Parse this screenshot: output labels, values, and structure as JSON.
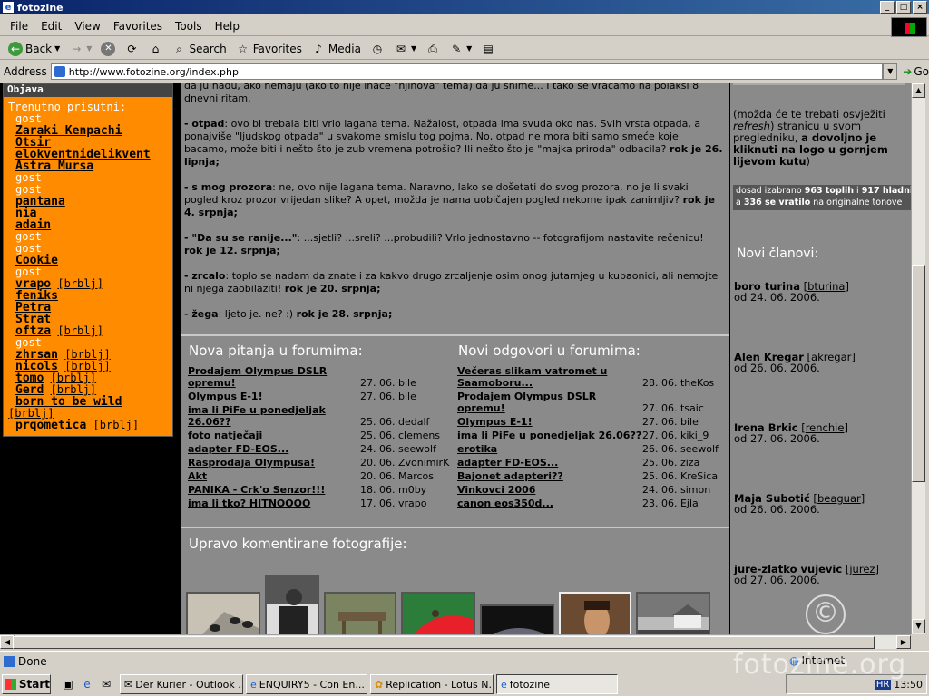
{
  "window": {
    "title": "fotozine"
  },
  "menu": [
    "File",
    "Edit",
    "View",
    "Favorites",
    "Tools",
    "Help"
  ],
  "toolbar": {
    "back": "Back",
    "search": "Search",
    "favorites": "Favorites",
    "media": "Media"
  },
  "address": {
    "label": "Address",
    "url": "http://www.fotozine.org/index.php",
    "go": "Go"
  },
  "left": {
    "header": "Objava",
    "present_label": "Trenutno prisutni:",
    "users": [
      {
        "name": "gost",
        "type": "guest"
      },
      {
        "name": "Zaraki Kenpachi",
        "type": "user"
      },
      {
        "name": "Otsir",
        "type": "user"
      },
      {
        "name": "elokventnidelikvent",
        "type": "user"
      },
      {
        "name": "Astra Mursa",
        "type": "user"
      },
      {
        "name": "gost",
        "type": "guest"
      },
      {
        "name": "gost",
        "type": "guest"
      },
      {
        "name": "pantana",
        "type": "user"
      },
      {
        "name": "nia",
        "type": "user"
      },
      {
        "name": "adain",
        "type": "user"
      },
      {
        "name": "gost",
        "type": "guest"
      },
      {
        "name": "gost",
        "type": "guest"
      },
      {
        "name": "Cookie",
        "type": "user"
      },
      {
        "name": "gost",
        "type": "guest"
      },
      {
        "name": "vrapo",
        "type": "user",
        "extra": "[brblj]"
      },
      {
        "name": "feniks",
        "type": "user"
      },
      {
        "name": "Petra",
        "type": "user"
      },
      {
        "name": "Strat",
        "type": "user"
      },
      {
        "name": "oftza",
        "type": "user",
        "extra": "[brblj]"
      },
      {
        "name": "gost",
        "type": "guest"
      },
      {
        "name": "zhrsan",
        "type": "user",
        "extra": "[brblj]"
      },
      {
        "name": "nicols",
        "type": "user",
        "extra": "[brblj]"
      },
      {
        "name": "tomo",
        "type": "user",
        "extra": "[brblj]"
      },
      {
        "name": "Gerd",
        "type": "user",
        "extra": "[brblj]"
      },
      {
        "name": "born to be wild",
        "type": "user",
        "extra": "[brblj]",
        "wrap": true
      },
      {
        "name": "prqometica",
        "type": "user",
        "extra": "[brblj]"
      }
    ]
  },
  "topics": [
    {
      "lead": "",
      "text": "da ju nađu, ako nemaju (ako to nije inače \"njihova\" tema) da ju snime... I tako se vraćamo na polaksi 8 dnevni ritam.",
      "deadline": ""
    },
    {
      "lead": "- otpad",
      "text": ": ovo bi trebala biti vrlo lagana tema. Nažalost, otpada ima svuda oko nas. Svih vrsta otpada, a ponajviše \"ljudskog otpada\" u svakome smislu tog pojma. No, otpad ne mora biti samo smeće koje bacamo, može biti i nešto što je zub vremena potrošio? Ili nešto što je \"majka priroda\" odbacila?",
      "deadline": "rok je 26. lipnja;"
    },
    {
      "lead": "- s mog prozora",
      "text": ": ne, ovo nije lagana tema. Naravno, lako se došetati do svog prozora, no je li svaki pogled kroz prozor vrijedan slike? A opet, možda je nama uobičajen pogled nekome ipak zanimljiv?",
      "deadline": "rok je 4. srpnja;"
    },
    {
      "lead": "- \"Da su se ranije...\"",
      "text": ": ...sjetli? ...sreli? ...probudili? Vrlo jednostavno -- fotografijom nastavite rečenicu!",
      "deadline": "rok je 12. srpnja;"
    },
    {
      "lead": "- zrcalo",
      "text": ": toplo se nadam da znate i za kakvo drugo zrcaljenje osim onog jutarnjeg u kupaonici, ali nemojte ni njega zaobilaziti!",
      "deadline": "rok je 20. srpnja;"
    },
    {
      "lead": "- žega",
      "text": ": ljeto je. ne? :)",
      "deadline": "rok je 28. srpnja;"
    }
  ],
  "forum_new": {
    "title": "Nova pitanja u forumima:",
    "items": [
      {
        "title": "Prodajem Olympus DSLR opremu!",
        "date": "27. 06.",
        "user": "bile"
      },
      {
        "title": "Olympus E-1!",
        "date": "27. 06.",
        "user": "bile"
      },
      {
        "title": "ima li PiFe u ponedjeljak 26.06??",
        "date": "25. 06.",
        "user": "dedalf"
      },
      {
        "title": "foto natječaji",
        "date": "25. 06.",
        "user": "clemens"
      },
      {
        "title": "adapter FD-EOS...",
        "date": "24. 06.",
        "user": "seewolf"
      },
      {
        "title": "Rasprodaja Olympusa!",
        "date": "20. 06.",
        "user": "ZvonimirK"
      },
      {
        "title": "Akt",
        "date": "20. 06.",
        "user": "Marcos"
      },
      {
        "title": "PANIKA - Crk'o Senzor!!!",
        "date": "18. 06.",
        "user": "m0by"
      },
      {
        "title": "ima li tko? HITNOOOO",
        "date": "17. 06.",
        "user": "vrapo"
      }
    ]
  },
  "forum_replies": {
    "title": "Novi odgovori u forumima:",
    "items": [
      {
        "title": "Večeras slikam vatromet u Saamoboru...",
        "date": "28. 06.",
        "user": "theKos"
      },
      {
        "title": "Prodajem Olympus DSLR opremu!",
        "date": "27. 06.",
        "user": "tsaic"
      },
      {
        "title": "Olympus E-1!",
        "date": "27. 06.",
        "user": "bile"
      },
      {
        "title": "ima li PiFe u ponedjeljak 26.06??",
        "date": "27. 06.",
        "user": "kiki_9"
      },
      {
        "title": "erotika",
        "date": "26. 06.",
        "user": "seewolf"
      },
      {
        "title": "adapter FD-EOS...",
        "date": "25. 06.",
        "user": "ziza"
      },
      {
        "title": "Bajonet adapteri??",
        "date": "25. 06.",
        "user": "KreSica"
      },
      {
        "title": "Vinkovci 2006",
        "date": "24. 06.",
        "user": "simon"
      },
      {
        "title": "canon eos350d...",
        "date": "23. 06.",
        "user": "Ejla"
      }
    ]
  },
  "photos_title": "Upravo komentirane fotografije:",
  "right": {
    "note_pre": "(možda će te trebati osvježiti ",
    "note_refresh": "refresh",
    "note_mid": ") stranicu u svom pregledniku, ",
    "note_bold": "a dovoljno je kliknuti na logo u gornjem lijevom kutu",
    "note_post": ")",
    "banner_a": "dosad izabrano ",
    "banner_b": "963 toplih",
    "banner_c": " i ",
    "banner_d": "917 hladnih",
    "banner_e": "a ",
    "banner_f": "336 se vratilo",
    "banner_g": " na originalne tonove",
    "members_title": "Novi članovi:",
    "members": [
      {
        "name": "boro turina",
        "nick": "bturina",
        "date": "od 24. 06. 2006."
      },
      {
        "name": "Alen Kregar",
        "nick": "akregar",
        "date": "od 26. 06. 2006."
      },
      {
        "name": "Irena Brkic",
        "nick": "renchie",
        "date": "od 27. 06. 2006."
      },
      {
        "name": "Maja Subotić",
        "nick": "beaguar",
        "date": "od 26. 06. 2006."
      },
      {
        "name": "jure-zlatko vujevic",
        "nick": "jurez",
        "date": "od 27. 06. 2006."
      }
    ]
  },
  "status": {
    "done": "Done",
    "zone": "Internet"
  },
  "taskbar": {
    "start": "Start",
    "tasks": [
      "Der Kurier - Outlook ...",
      "ENQUIRY5 - Con En...",
      "Replication - Lotus N...",
      "fotozine"
    ],
    "clock": "13:50",
    "tray_lang": "HR"
  },
  "watermark": "fotozine.org",
  "copyright_symbol": "©",
  "colors": {
    "orange": "#ff8c00",
    "gray_panel": "#8a8a8a",
    "title_blue": "#0a246a"
  }
}
